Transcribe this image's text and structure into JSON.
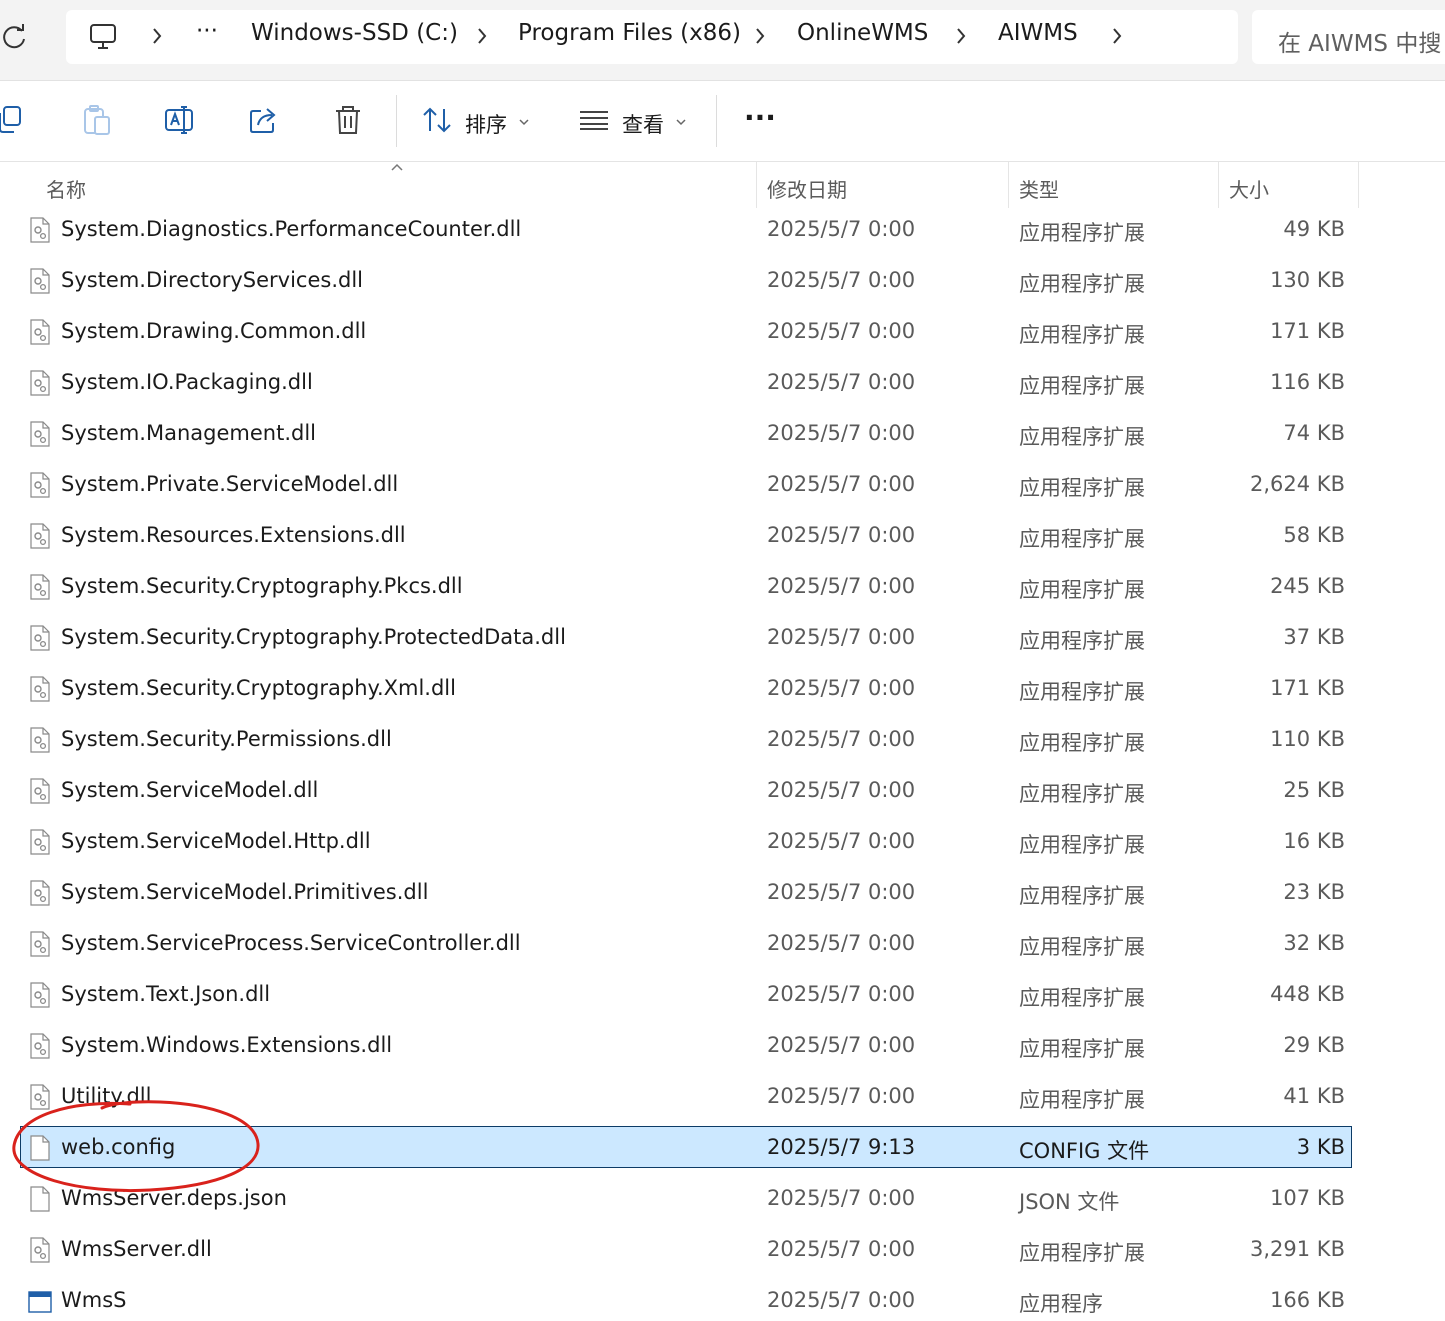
{
  "address": {
    "crumbs": [
      "Windows-SSD (C:)",
      "Program Files (x86)",
      "OnlineWMS",
      "AIWMS"
    ],
    "overflow": "···",
    "search_placeholder": "在 AIWMS 中搜"
  },
  "toolbar": {
    "sort_label": "排序",
    "view_label": "查看",
    "more_label": "···"
  },
  "columns": {
    "name": "名称",
    "date": "修改日期",
    "type": "类型",
    "size": "大小"
  },
  "files": [
    {
      "name": "System.Diagnostics.PerformanceCounter.dll",
      "date": "2025/5/7 0:00",
      "type": "应用程序扩展",
      "size": "49 KB",
      "icon": "dll-file-icon"
    },
    {
      "name": "System.DirectoryServices.dll",
      "date": "2025/5/7 0:00",
      "type": "应用程序扩展",
      "size": "130 KB",
      "icon": "dll-file-icon"
    },
    {
      "name": "System.Drawing.Common.dll",
      "date": "2025/5/7 0:00",
      "type": "应用程序扩展",
      "size": "171 KB",
      "icon": "dll-file-icon"
    },
    {
      "name": "System.IO.Packaging.dll",
      "date": "2025/5/7 0:00",
      "type": "应用程序扩展",
      "size": "116 KB",
      "icon": "dll-file-icon"
    },
    {
      "name": "System.Management.dll",
      "date": "2025/5/7 0:00",
      "type": "应用程序扩展",
      "size": "74 KB",
      "icon": "dll-file-icon"
    },
    {
      "name": "System.Private.ServiceModel.dll",
      "date": "2025/5/7 0:00",
      "type": "应用程序扩展",
      "size": "2,624 KB",
      "icon": "dll-file-icon"
    },
    {
      "name": "System.Resources.Extensions.dll",
      "date": "2025/5/7 0:00",
      "type": "应用程序扩展",
      "size": "58 KB",
      "icon": "dll-file-icon"
    },
    {
      "name": "System.Security.Cryptography.Pkcs.dll",
      "date": "2025/5/7 0:00",
      "type": "应用程序扩展",
      "size": "245 KB",
      "icon": "dll-file-icon"
    },
    {
      "name": "System.Security.Cryptography.ProtectedData.dll",
      "date": "2025/5/7 0:00",
      "type": "应用程序扩展",
      "size": "37 KB",
      "icon": "dll-file-icon"
    },
    {
      "name": "System.Security.Cryptography.Xml.dll",
      "date": "2025/5/7 0:00",
      "type": "应用程序扩展",
      "size": "171 KB",
      "icon": "dll-file-icon"
    },
    {
      "name": "System.Security.Permissions.dll",
      "date": "2025/5/7 0:00",
      "type": "应用程序扩展",
      "size": "110 KB",
      "icon": "dll-file-icon"
    },
    {
      "name": "System.ServiceModel.dll",
      "date": "2025/5/7 0:00",
      "type": "应用程序扩展",
      "size": "25 KB",
      "icon": "dll-file-icon"
    },
    {
      "name": "System.ServiceModel.Http.dll",
      "date": "2025/5/7 0:00",
      "type": "应用程序扩展",
      "size": "16 KB",
      "icon": "dll-file-icon"
    },
    {
      "name": "System.ServiceModel.Primitives.dll",
      "date": "2025/5/7 0:00",
      "type": "应用程序扩展",
      "size": "23 KB",
      "icon": "dll-file-icon"
    },
    {
      "name": "System.ServiceProcess.ServiceController.dll",
      "date": "2025/5/7 0:00",
      "type": "应用程序扩展",
      "size": "32 KB",
      "icon": "dll-file-icon"
    },
    {
      "name": "System.Text.Json.dll",
      "date": "2025/5/7 0:00",
      "type": "应用程序扩展",
      "size": "448 KB",
      "icon": "dll-file-icon"
    },
    {
      "name": "System.Windows.Extensions.dll",
      "date": "2025/5/7 0:00",
      "type": "应用程序扩展",
      "size": "29 KB",
      "icon": "dll-file-icon"
    },
    {
      "name": "Utility.dll",
      "date": "2025/5/7 0:00",
      "type": "应用程序扩展",
      "size": "41 KB",
      "icon": "dll-file-icon"
    },
    {
      "name": "web.config",
      "date": "2025/5/7 9:13",
      "type": "CONFIG 文件",
      "size": "3 KB",
      "icon": "blank-file-icon",
      "selected": true
    },
    {
      "name": "WmsServer.deps.json",
      "date": "2025/5/7 0:00",
      "type": "JSON 文件",
      "size": "107 KB",
      "icon": "blank-file-icon"
    },
    {
      "name": "WmsServer.dll",
      "date": "2025/5/7 0:00",
      "type": "应用程序扩展",
      "size": "3,291 KB",
      "icon": "dll-file-icon"
    },
    {
      "name": "WmsS",
      "date": "2025/5/7 0:00",
      "type": "应用程序",
      "size": "166 KB",
      "icon": "exe-file-icon"
    }
  ],
  "colors": {
    "selection_bg": "#cce8ff",
    "selection_border": "#0c3b66",
    "annotation": "#d9221c"
  }
}
